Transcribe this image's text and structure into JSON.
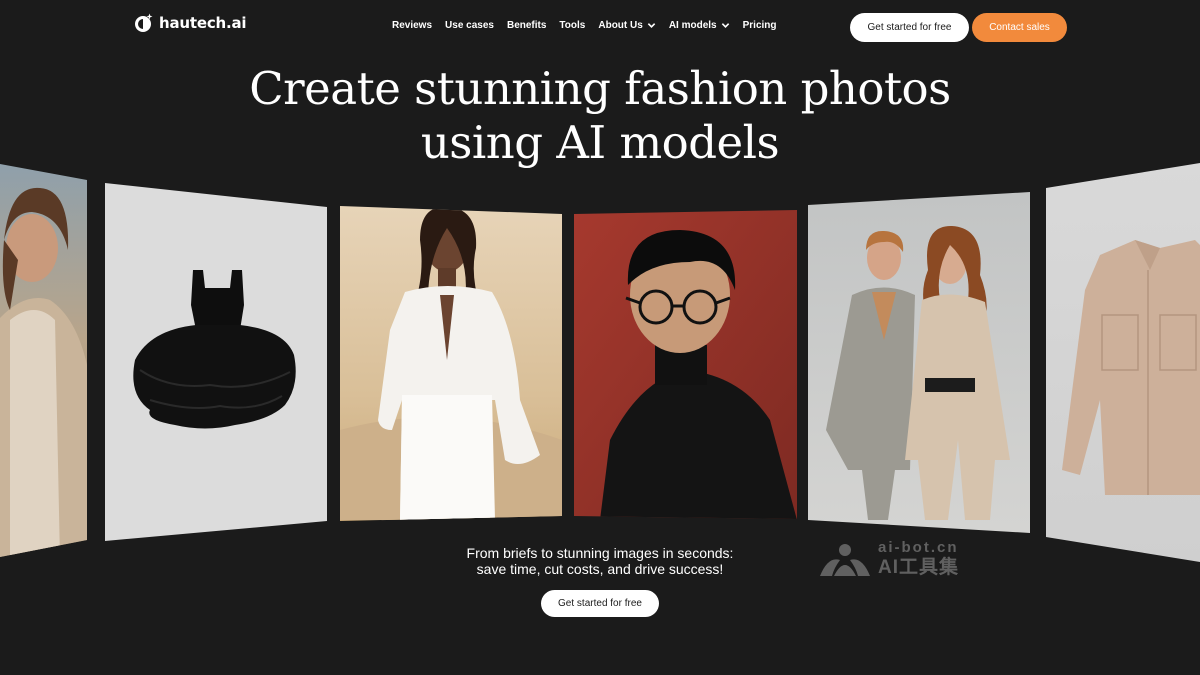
{
  "brand": {
    "name": "hautech.ai"
  },
  "nav": {
    "items": [
      {
        "label": "Reviews",
        "dropdown": false
      },
      {
        "label": "Use cases",
        "dropdown": false
      },
      {
        "label": "Benefits",
        "dropdown": false
      },
      {
        "label": "Tools",
        "dropdown": false
      },
      {
        "label": "About Us",
        "dropdown": true
      },
      {
        "label": "AI models",
        "dropdown": true
      },
      {
        "label": "Pricing",
        "dropdown": false
      }
    ],
    "cta_primary": "Get started for free",
    "cta_secondary": "Contact sales"
  },
  "hero": {
    "title_line1": "Create stunning fashion photos",
    "title_line2": "using AI models",
    "subtitle_line1": "From briefs to stunning images in seconds:",
    "subtitle_line2": "save time, cut costs, and drive success!",
    "cta": "Get started for free"
  },
  "gallery": [
    {
      "subject": "woman-in-beige-coat"
    },
    {
      "subject": "black-tulle-dress"
    },
    {
      "subject": "woman-in-white-outfit"
    },
    {
      "subject": "man-with-glasses-red-background"
    },
    {
      "subject": "couple-in-beige-suits"
    },
    {
      "subject": "beige-shirt-jacket"
    }
  ],
  "watermark": {
    "line1": "ai-bot.cn",
    "line2": "AI工具集"
  },
  "colors": {
    "background": "#1b1b1b",
    "accent": "#f28a3c",
    "text": "#ffffff"
  }
}
